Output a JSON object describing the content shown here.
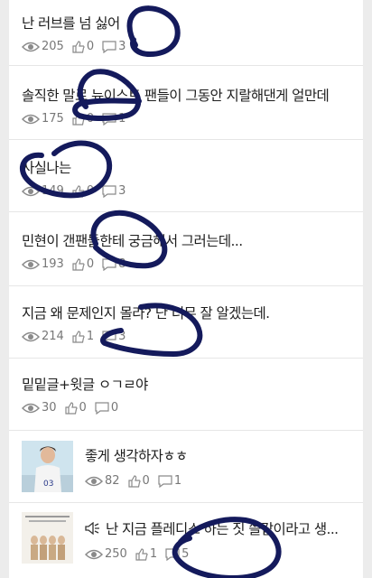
{
  "posts": [
    {
      "title": "난 러브를 넘 싫어",
      "views": "205",
      "likes": "0",
      "comments": "3"
    },
    {
      "title": "솔직한 말로 뉴이스트 팬들이 그동안 지랄해댄게 얼만데",
      "views": "175",
      "likes": "0",
      "comments": "1"
    },
    {
      "title": "사실나는",
      "views": "149",
      "likes": "0",
      "comments": "3"
    },
    {
      "title": "민현이 갠팬들한테 궁금해서 그러는데...",
      "views": "193",
      "likes": "0",
      "comments": "8"
    },
    {
      "title": "지금 왜 문제인지 몰라? 난 너무 잘 알겠는데.",
      "views": "214",
      "likes": "1",
      "comments": "3"
    },
    {
      "title": "밑밑글+윗글 ㅇㄱㄹ야",
      "views": "30",
      "likes": "0",
      "comments": "0"
    },
    {
      "title": "좋게 생각하자ㅎㅎ",
      "views": "82",
      "likes": "0",
      "comments": "1"
    },
    {
      "title": "난 지금 플레디스 하는 짓 쓸갑이라고 생...",
      "views": "250",
      "likes": "1",
      "comments": "5"
    }
  ],
  "icons": {
    "views": "eye-icon",
    "likes": "thumbs-up-icon",
    "comments": "comment-icon",
    "speaker": "speaker-icon"
  },
  "colors": {
    "scribble": "#141a5c",
    "meta": "#777777"
  }
}
